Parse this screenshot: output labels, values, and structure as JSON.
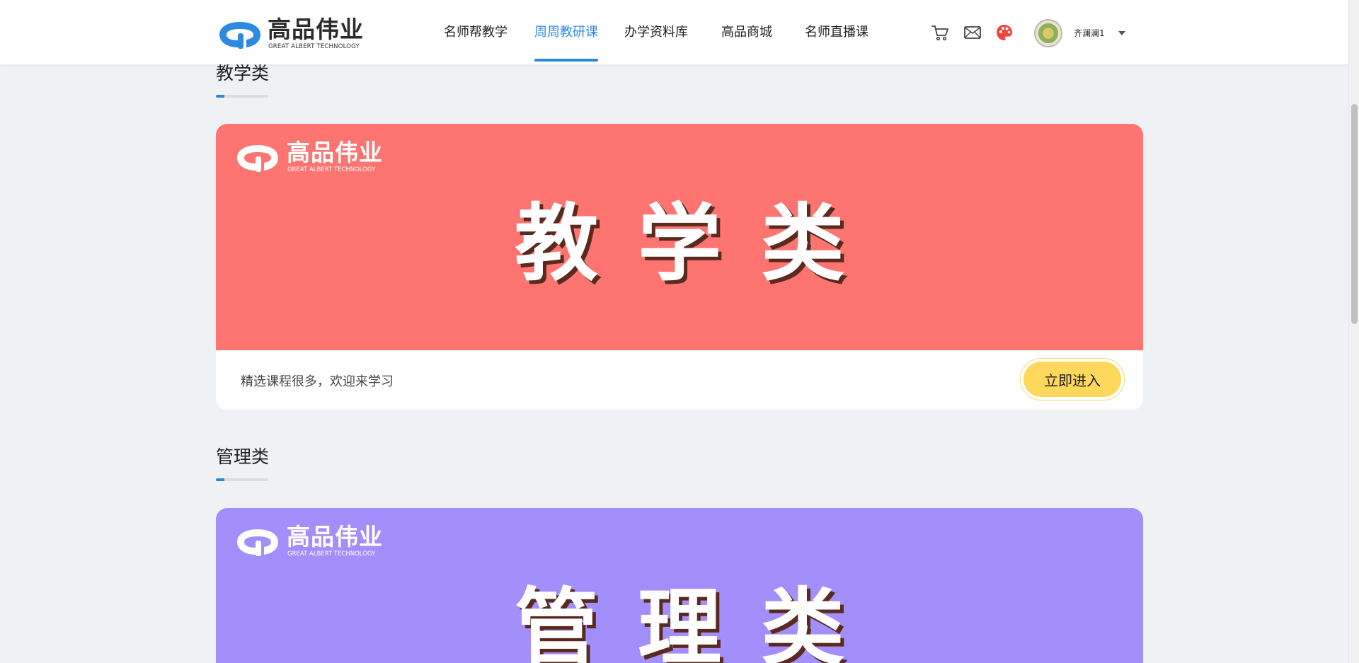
{
  "brand": {
    "name_cn": "高品伟业",
    "name_en": "GREAT ALBERT TECHNOLOGY",
    "color": "#2e8ae0"
  },
  "nav": {
    "items": [
      {
        "label": "名师帮教学",
        "active": false
      },
      {
        "label": "周周教研课",
        "active": true
      },
      {
        "label": "办学资料库",
        "active": false
      },
      {
        "label": "高品商城",
        "active": false
      },
      {
        "label": "名师直播课",
        "active": false
      }
    ],
    "active_color": "#2e8ae0"
  },
  "header_icons": [
    "cart-icon",
    "mail-icon",
    "palette-icon"
  ],
  "user": {
    "name": "齐澜澜1",
    "avatar": "avatar"
  },
  "sections": [
    {
      "title": "教学类",
      "banner_title": "教学类",
      "banner_color": "#fd7471",
      "description": "精选课程很多，欢迎来学习",
      "button_label": "立即进入"
    },
    {
      "title": "管理类",
      "banner_title": "管理类",
      "banner_color": "#a28ffb"
    }
  ],
  "colors": {
    "page_background": "#f0f1f4",
    "button_yellow": "#fdd85a"
  }
}
